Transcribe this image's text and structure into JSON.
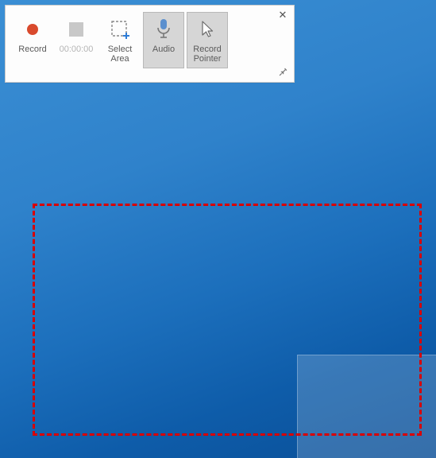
{
  "toolbar": {
    "record": {
      "label": "Record"
    },
    "timer": {
      "label": "00:00:00"
    },
    "selectArea": {
      "label": "Select\nArea"
    },
    "audio": {
      "label": "Audio"
    },
    "pointer": {
      "label": "Record\nPointer"
    },
    "close": {
      "glyph": "✕"
    },
    "pin": {
      "glyph": "📌"
    }
  }
}
